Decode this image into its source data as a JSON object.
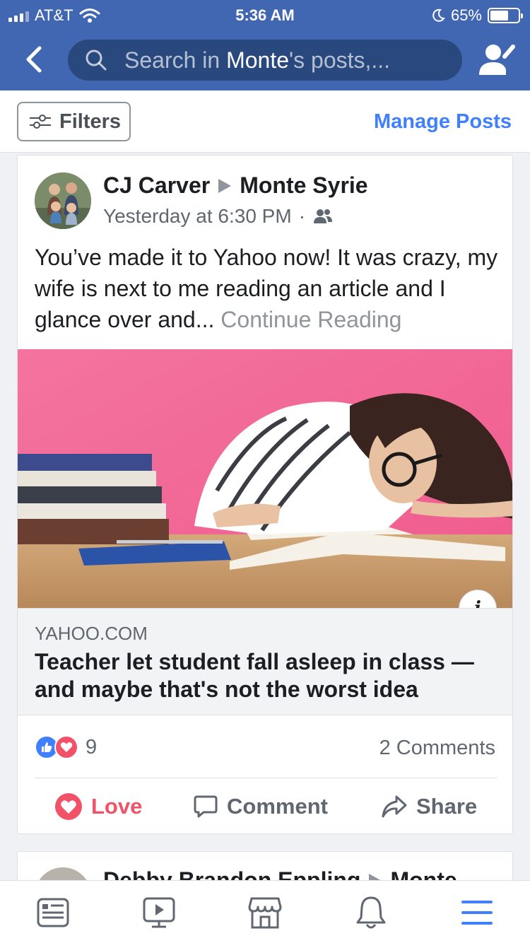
{
  "status_bar": {
    "carrier": "AT&T",
    "time": "5:36 AM",
    "battery": "65%",
    "battery_level": 0.65
  },
  "header": {
    "search_prefix": "Search in ",
    "search_highlight": "Monte",
    "search_suffix": "'s posts,..."
  },
  "filter_bar": {
    "filters_label": "Filters",
    "manage_label": "Manage Posts"
  },
  "post": {
    "author": "CJ Carver",
    "target": "Monte Syrie",
    "timestamp": "Yesterday at 6:30 PM",
    "separator": "·",
    "text": "You’ve made it to Yahoo now! It was crazy, my wife is next to me reading an article and I glance over and...",
    "continue": "Continue Reading",
    "link": {
      "domain": "YAHOO.COM",
      "headline": "Teacher let student fall asleep in class — and maybe that's not the worst idea"
    },
    "reaction_count": "9",
    "comments": "2 Comments",
    "actions": {
      "love": "Love",
      "comment": "Comment",
      "share": "Share"
    }
  },
  "next_post": {
    "author": "Debby Brandon Eppling",
    "target": "Monte"
  },
  "colors": {
    "brand_blue": "#4267b2",
    "accent_blue": "#4080ff",
    "love_red": "#f25268"
  },
  "tabs": [
    "news-feed-icon",
    "watch-icon",
    "marketplace-icon",
    "notifications-icon",
    "menu-icon"
  ]
}
